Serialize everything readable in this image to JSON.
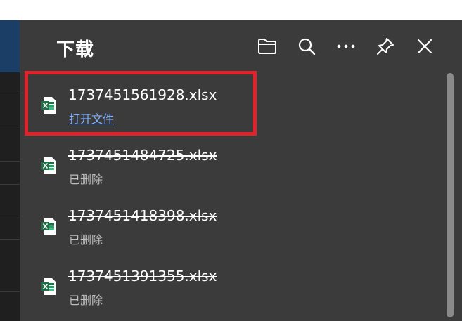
{
  "panel": {
    "title": "下载",
    "toolbar": {
      "folder_icon": "folder-icon",
      "search_icon": "search-icon",
      "more_icon": "more-icon",
      "pin_icon": "pin-icon",
      "close_icon": "close-icon"
    },
    "items": [
      {
        "name": "1737451561928.xlsx",
        "status": "打开文件",
        "deleted": false,
        "icon": "excel-file-icon"
      },
      {
        "name": "1737451484725.xlsx",
        "status": "已删除",
        "deleted": true,
        "icon": "excel-file-icon"
      },
      {
        "name": "1737451418398.xlsx",
        "status": "已删除",
        "deleted": true,
        "icon": "excel-file-icon"
      },
      {
        "name": "1737451391355.xlsx",
        "status": "已删除",
        "deleted": true,
        "icon": "excel-file-icon"
      }
    ]
  },
  "colors": {
    "panel_bg": "#3b3b3b",
    "highlight": "#e0232a",
    "link": "#7fb1ff",
    "excel_green": "#1e7145"
  }
}
